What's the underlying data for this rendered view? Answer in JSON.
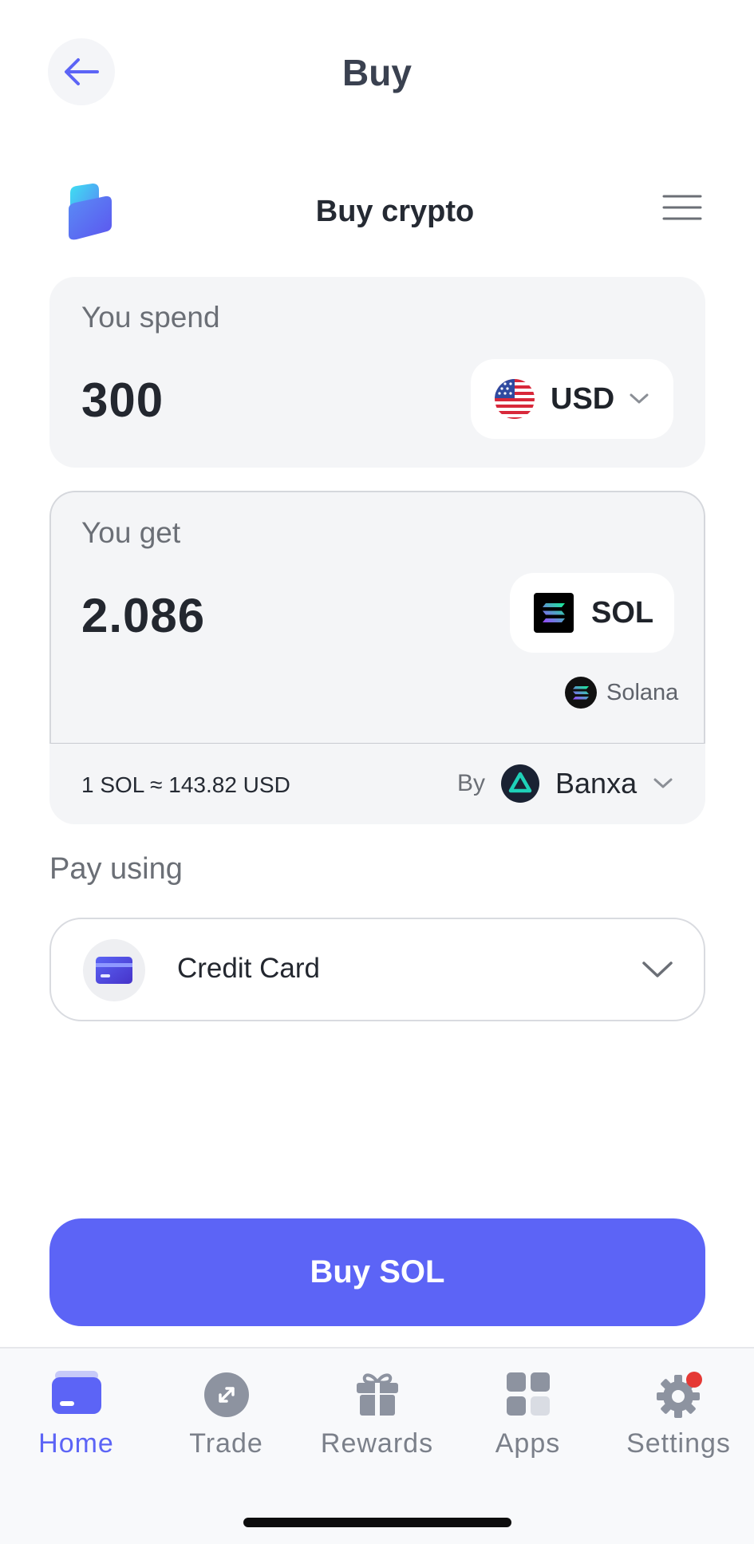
{
  "header": {
    "title": "Buy"
  },
  "widget": {
    "title": "Buy crypto"
  },
  "spend": {
    "label": "You spend",
    "amount": "300",
    "currency": "USD"
  },
  "get": {
    "label": "You get",
    "amount": "2.086",
    "currency": "SOL",
    "network": "Solana",
    "rate": "1 SOL ≈ 143.82 USD",
    "by_label": "By",
    "provider": "Banxa"
  },
  "pay": {
    "label": "Pay using",
    "method": "Credit Card"
  },
  "cta": {
    "label": "Buy SOL"
  },
  "tabs": [
    {
      "label": "Home",
      "icon": "home-icon",
      "active": true
    },
    {
      "label": "Trade",
      "icon": "trade-icon",
      "active": false
    },
    {
      "label": "Rewards",
      "icon": "gift-icon",
      "active": false
    },
    {
      "label": "Apps",
      "icon": "apps-icon",
      "active": false
    },
    {
      "label": "Settings",
      "icon": "gear-icon",
      "active": false,
      "badge": true
    }
  ],
  "colors": {
    "accent": "#5c64f6",
    "card_bg": "#f4f5f7",
    "badge": "#e53935"
  }
}
